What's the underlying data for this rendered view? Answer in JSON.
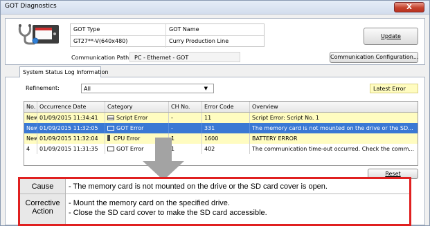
{
  "window": {
    "title": "GOT Diagnostics",
    "close_label": "X"
  },
  "header": {
    "got_type_label": "GOT Type",
    "got_type_value": "GT27**-V(640x480)",
    "got_name_label": "GOT Name",
    "got_name_value": "Curry Production Line",
    "comm_path_label": "Communication Path:",
    "comm_path_value": "PC - Ethernet - GOT",
    "update_label": "Update",
    "comm_config_label": "Communication Configuration..."
  },
  "tabs": [
    "System Status Log Information"
  ],
  "filter": {
    "label": "Refinement:",
    "value": "All",
    "latest_error_label": "Latest Error"
  },
  "table": {
    "columns": [
      "No.",
      "Occurrence Date",
      "Category",
      "CH No.",
      "Error Code",
      "Overview"
    ],
    "rows": [
      {
        "no": "New",
        "date": "01/09/2015 11:34:41",
        "category": "Script Error",
        "icon": "script-icon",
        "ch": "-",
        "code": "11",
        "overview": "Script Error: Script No. 1",
        "style": "yellow"
      },
      {
        "no": "New",
        "date": "01/09/2015 11:32:05",
        "category": "GOT Error",
        "icon": "monitor-icon",
        "ch": "-",
        "code": "331",
        "overview": "The memory card is not mounted on the drive or the SD...",
        "style": "selected"
      },
      {
        "no": "New",
        "date": "01/09/2015 11:32:04",
        "category": "CPU Error",
        "icon": "cpu-icon",
        "ch": "1",
        "code": "1600",
        "overview": "BATTERY ERROR",
        "style": "yellow"
      },
      {
        "no": "4",
        "date": "01/09/2015 11:31:35",
        "category": "GOT Error",
        "icon": "monitor-icon",
        "ch": "1",
        "code": "402",
        "overview": "The communication time-out occurred. Check the comm...",
        "style": "white"
      }
    ]
  },
  "reset_label": "Reset",
  "detail": {
    "cause_label": "Cause",
    "cause_text": "- The memory card is not mounted on the drive or the SD card cover is open.",
    "action_label_1": "Corrective",
    "action_label_2": "Action",
    "action_line_1": "- Mount the memory card on the specified drive.",
    "action_line_2": "- Close the SD card cover to make the SD card accessible."
  },
  "colors": {
    "row_yellow": "#fffcc0",
    "row_selected": "#3a78d4",
    "callout_border": "#e02020",
    "arrow": "#999999"
  }
}
